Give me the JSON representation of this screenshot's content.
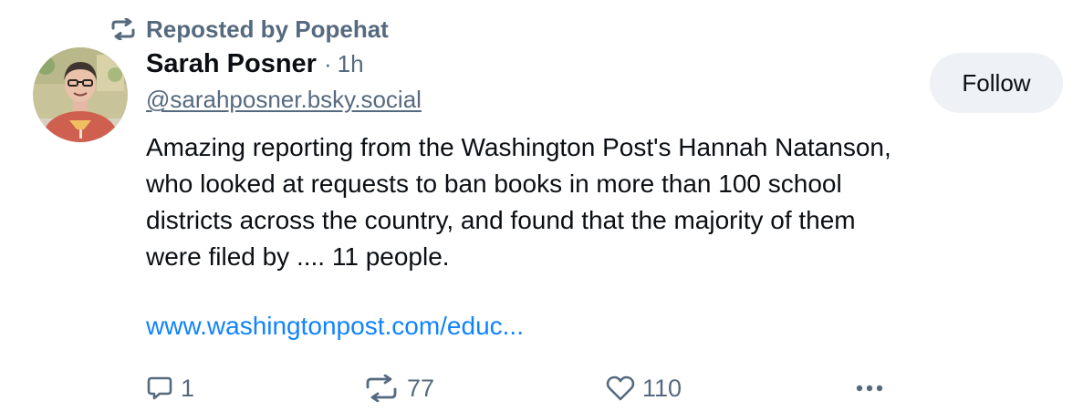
{
  "repost": {
    "label": "Reposted by Popehat",
    "icon": "repost-icon"
  },
  "author": {
    "name": "Sarah Posner",
    "separator": "·",
    "time": "1h",
    "handle": "@sarahposner.bsky.social",
    "avatar": "avatar-photo"
  },
  "follow_label": "Follow",
  "post": {
    "lines": [
      "Amazing reporting from the Washington Post's Hannah Natanson,",
      "who looked at requests to ban books in more than 100 school",
      "districts across the country, and found that the majority of them",
      "were filed by .... 11 people."
    ],
    "link": "www.washingtonpost.com/educ..."
  },
  "actions": {
    "replies": "1",
    "reposts": "77",
    "likes": "110",
    "more_icon": "more-icon"
  },
  "colors": {
    "text": "#0b0f14",
    "muted": "#566a7f",
    "link": "#1083fe",
    "button_bg": "#eef1f5"
  }
}
